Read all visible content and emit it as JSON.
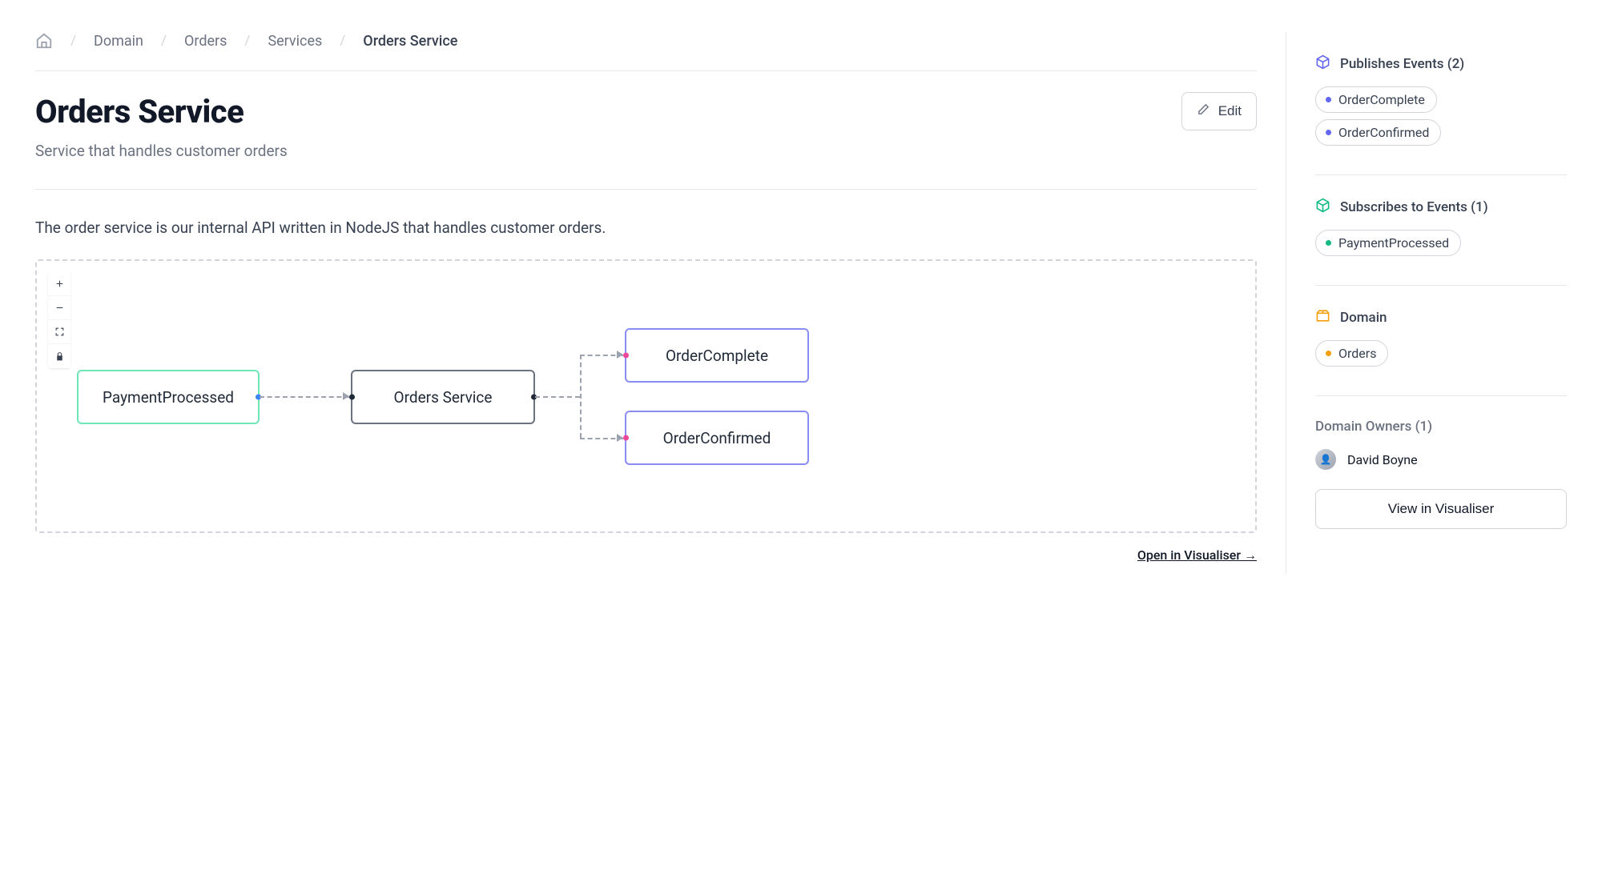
{
  "breadcrumb": {
    "items": [
      "Domain",
      "Orders",
      "Services",
      "Orders Service"
    ]
  },
  "header": {
    "title": "Orders Service",
    "subtitle": "Service that handles customer orders",
    "edit_label": "Edit"
  },
  "body": {
    "description": "The order service is our internal API written in NodeJS that handles customer orders.",
    "open_link": "Open in Visualiser →"
  },
  "diagram": {
    "nodes": {
      "input": "PaymentProcessed",
      "service": "Orders Service",
      "out1": "OrderComplete",
      "out2": "OrderConfirmed"
    }
  },
  "sidebar": {
    "publishes": {
      "title": "Publishes Events (2)",
      "items": [
        "OrderComplete",
        "OrderConfirmed"
      ]
    },
    "subscribes": {
      "title": "Subscribes to Events (1)",
      "items": [
        "PaymentProcessed"
      ]
    },
    "domain": {
      "title": "Domain",
      "items": [
        "Orders"
      ]
    },
    "owners": {
      "title": "Domain Owners (1)",
      "people": [
        "David Boyne"
      ]
    },
    "view_button": "View in Visualiser"
  }
}
